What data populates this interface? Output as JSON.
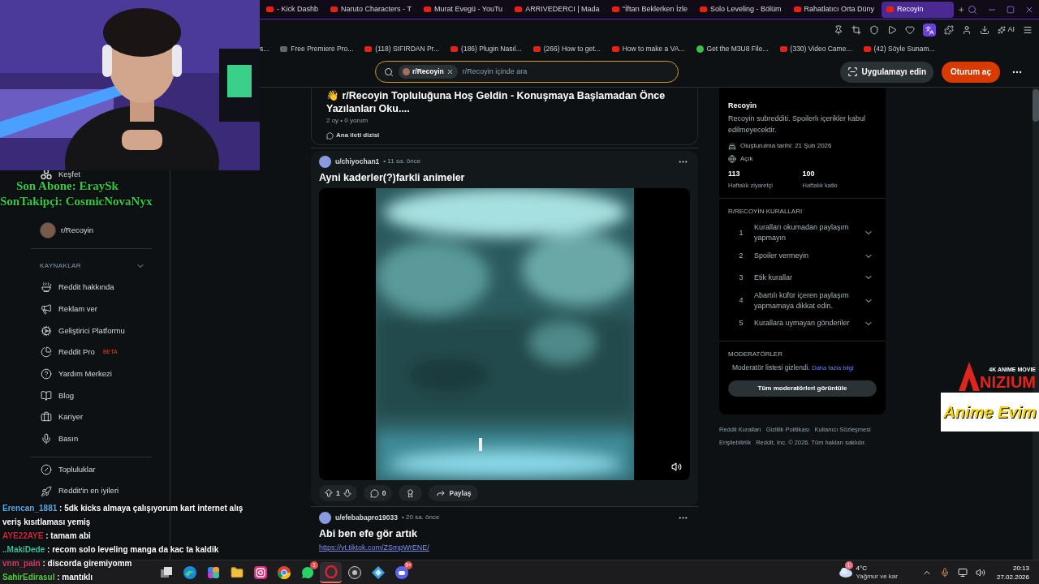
{
  "browser": {
    "tabs": [
      {
        "title": "- Kick Dashb",
        "selected": false
      },
      {
        "title": "Naruto Characters - T",
        "selected": false
      },
      {
        "title": "Murat Evegü - YouTu",
        "selected": false
      },
      {
        "title": "ARRIVEDERCI | Mada",
        "selected": false
      },
      {
        "title": "''İftarı Beklerken İzle",
        "selected": false
      },
      {
        "title": "Solo Leveling - Bölüm",
        "selected": false
      },
      {
        "title": "Rahatlatıcı Orta Düny",
        "selected": false
      },
      {
        "title": "Recoyin",
        "selected": true
      }
    ],
    "toolbar": {
      "ai_label": "AI"
    },
    "bookmarks": [
      "s...",
      "Free Premiere Pro...",
      "(118) SIFIRDAN Pr...",
      "(186) Plugin Nasıl...",
      "(266) How to get...",
      "How to make a VA...",
      "Get the M3U8 File...",
      "(330) Video Came...",
      "(42) Söyle Sunam..."
    ]
  },
  "stream_overlay": {
    "subscriber": "Son Abone: EraySk",
    "follower": "SonTakipçi: CosmicNovaNyx"
  },
  "chat": [
    {
      "user": "Erencan_1881",
      "color": "#5aa8e8",
      "message": ": 5dk kicks almaya çalışıyorum kart internet alış veriş kısıtlaması yemiş"
    },
    {
      "user": "AYE22AYE",
      "color": "#d0243c",
      "message": ": tamam abi"
    },
    {
      "user": "..MakiDede",
      "color": "#2ec4a0",
      "message": ": recom solo leveling manga da kac ta kaldik"
    },
    {
      "user": "vnm_pain",
      "color": "#d04070",
      "message": ": discorda giremiyomm"
    },
    {
      "user": "SahirEdirasul",
      "color": "#52d23a",
      "message": ": mantıklı"
    }
  ],
  "sponsors": {
    "tagline": "4K ANIME MOVIE",
    "brand": "NIZIUM",
    "partner": "Anime Evim"
  },
  "header": {
    "search_chip": "r/Recoyin",
    "search_placeholder": "r/Recoyin içinde ara",
    "app_button": "Uygulamayı edin",
    "login_button": "Oturum aç"
  },
  "sidebar": {
    "explore": "Keşfet",
    "recent": [
      "r/Recoyin"
    ],
    "resources_heading": "KAYNAKLAR",
    "resources": [
      {
        "label": "Reddit hakkında"
      },
      {
        "label": "Reklam ver"
      },
      {
        "label": "Geliştirici Platformu"
      },
      {
        "label": "Reddit Pro",
        "badge": "BETA"
      },
      {
        "label": "Yardım Merkezi"
      },
      {
        "label": "Blog"
      },
      {
        "label": "Kariyer"
      },
      {
        "label": "Basın"
      }
    ],
    "more": [
      {
        "label": "Topluluklar"
      },
      {
        "label": "Reddit'in en iyileri"
      }
    ]
  },
  "feed": {
    "pinned": {
      "emoji": "👋",
      "title": "r/Recoyin Topluluğuna Hoş Geldin - Konuşmaya Başlamadan Önce Yazılanları Oku....",
      "meta": "2 oy • 0 yorum",
      "thread_button": "Ana ileti dizisi"
    },
    "posts": [
      {
        "kind": "video",
        "author": "u/chiyochan1",
        "time": "• 11 sa. önce",
        "title": "Ayni kaderler(?)farkli animeler",
        "votes": "1",
        "comments": "0",
        "share": "Paylaş"
      },
      {
        "kind": "link",
        "author": "u/efebabapro19033",
        "time": "• 20 sa. önce",
        "title": "Abi ben efe gör artık",
        "link": "https://vt.tiktok.com/ZSmpWrENE/"
      }
    ]
  },
  "about": {
    "name": "Recoyin",
    "description": "Recoyin subredditi. Spoilerlı içerikler kabul edilmeyecektir.",
    "created": "Oluşturulma tarihi: 21 Şub 2026",
    "visibility": "Açık",
    "stats": [
      {
        "value": "113",
        "label": "Haftalık ziyaretçi"
      },
      {
        "value": "100",
        "label": "Haftalık katkı"
      }
    ]
  },
  "rules": {
    "heading": "R/RECOYİN KURALLARI",
    "items": [
      {
        "number": "1",
        "text": "Kuralları okumadan paylaşım yapmayın"
      },
      {
        "number": "2",
        "text": "Spoiler vermeyin"
      },
      {
        "number": "3",
        "text": "Etik kurallar"
      },
      {
        "number": "4",
        "text": "Abartılı küfür içeren paylaşım yapmamaya dikkat edin."
      },
      {
        "number": "5",
        "text": "Kurallara uymayan gönderiler"
      }
    ]
  },
  "moderators": {
    "heading": "MODERATÖRLER",
    "note": "Moderatör listesi gizlendi.",
    "link": "Daha fazla bilgi",
    "button": "Tüm moderatörleri görüntüle"
  },
  "footer": [
    "Reddit Kuralları",
    "Gizlilik Politikası",
    "Kullanıcı Sözleşmesi",
    "Erişilebilirlik",
    "Reddit, Inc. © 2026. Tüm hakları saklıdır."
  ],
  "taskbar": {
    "apps": [
      {
        "kind": "stack",
        "selected": false
      },
      {
        "kind": "wave",
        "selected": false
      },
      {
        "kind": "swirl",
        "selected": false
      },
      {
        "kind": "folder",
        "selected": false
      },
      {
        "kind": "camera",
        "selected": false
      },
      {
        "kind": "tricolor",
        "selected": false
      },
      {
        "kind": "chat",
        "selected": false,
        "badge": "1"
      },
      {
        "kind": "ring",
        "selected": true
      },
      {
        "kind": "dark",
        "selected": false
      },
      {
        "kind": "diamond",
        "selected": false
      },
      {
        "kind": "gamepad",
        "selected": false,
        "badge": "9+"
      }
    ],
    "weather": {
      "badge": "1",
      "temperature": "4°C",
      "condition": "Yağmur ve kar"
    },
    "time": "20:13",
    "date": "27.02.2026"
  }
}
